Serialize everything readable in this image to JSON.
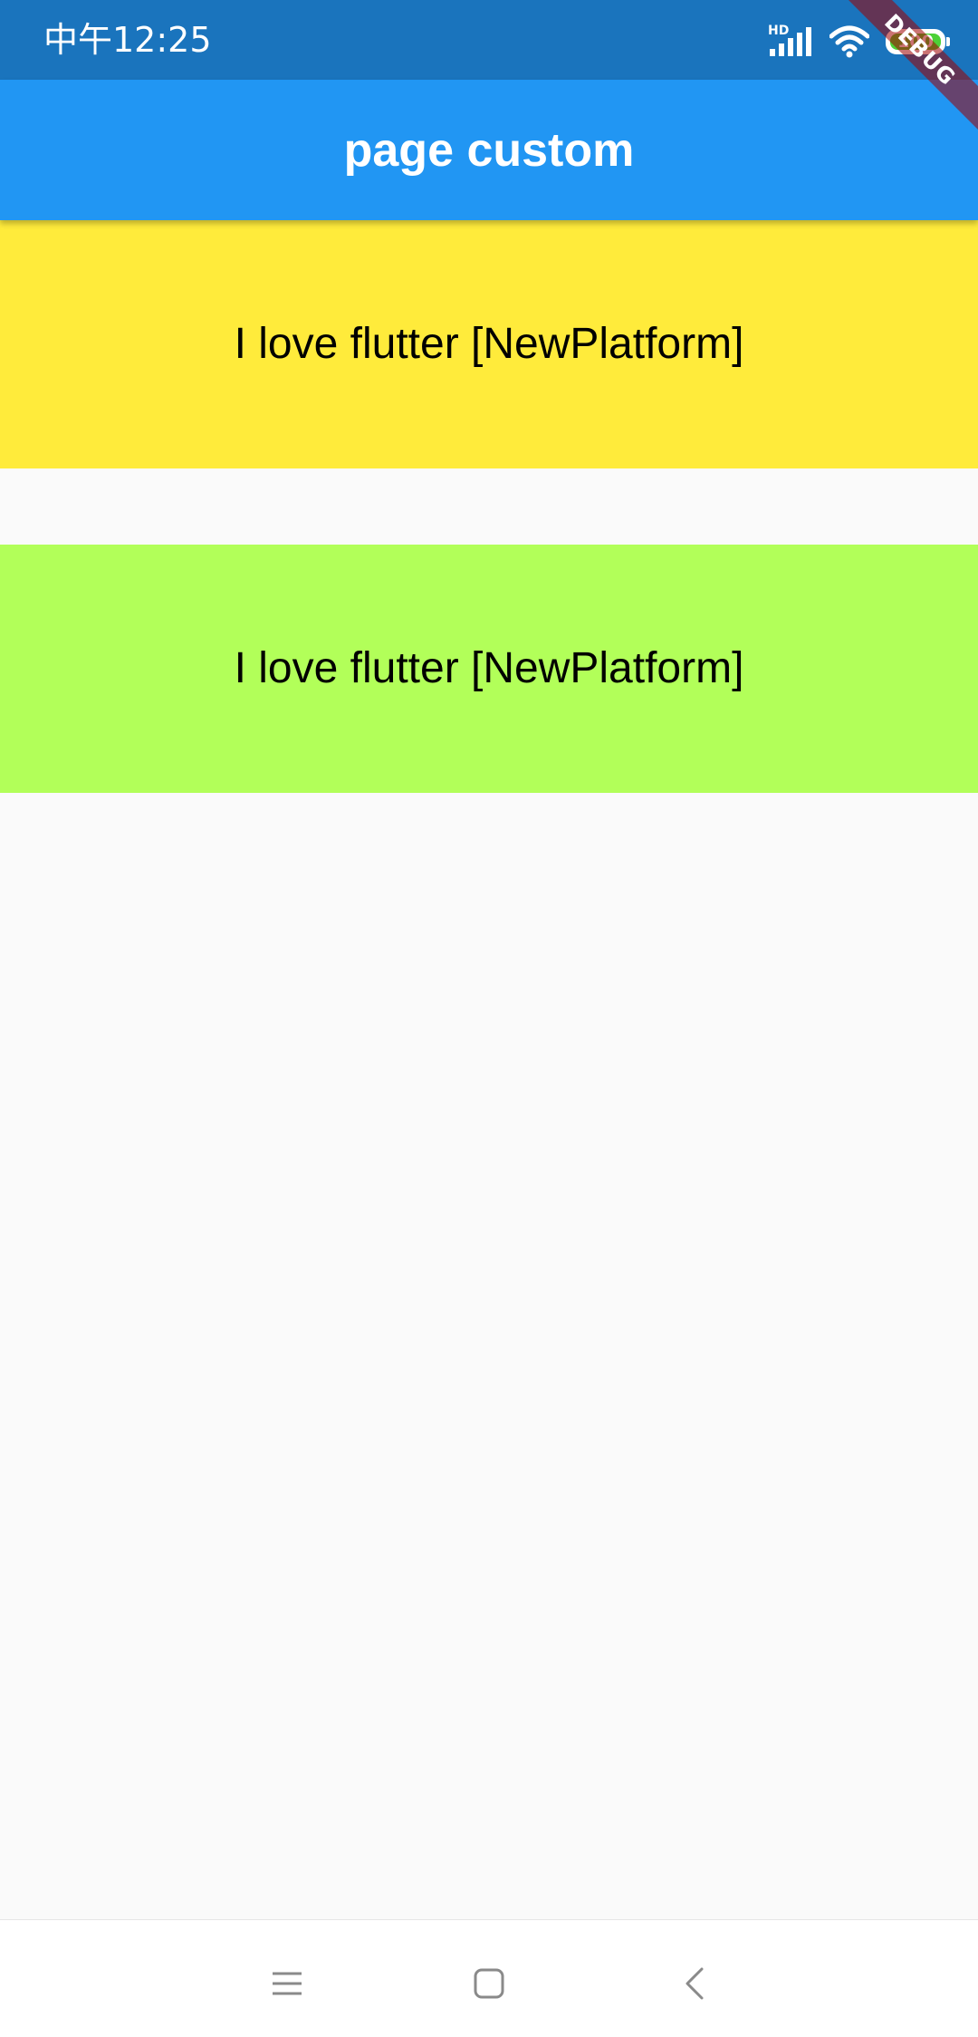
{
  "status_bar": {
    "time": "中午12:25",
    "network_label": "HD",
    "battery_level": "100",
    "background_color": "#1a74bd"
  },
  "app_bar": {
    "title": "page custom",
    "background_color": "#2196f3"
  },
  "debug_banner": {
    "label": "DEBUG"
  },
  "cards": [
    {
      "text": "I love flutter [NewPlatform]",
      "color": "#ffeb3b"
    },
    {
      "text": "I love flutter [NewPlatform]",
      "color": "#b2ff59"
    }
  ],
  "nav_bar": {
    "icons": [
      "menu-icon",
      "home-square-icon",
      "back-chevron-icon"
    ]
  }
}
